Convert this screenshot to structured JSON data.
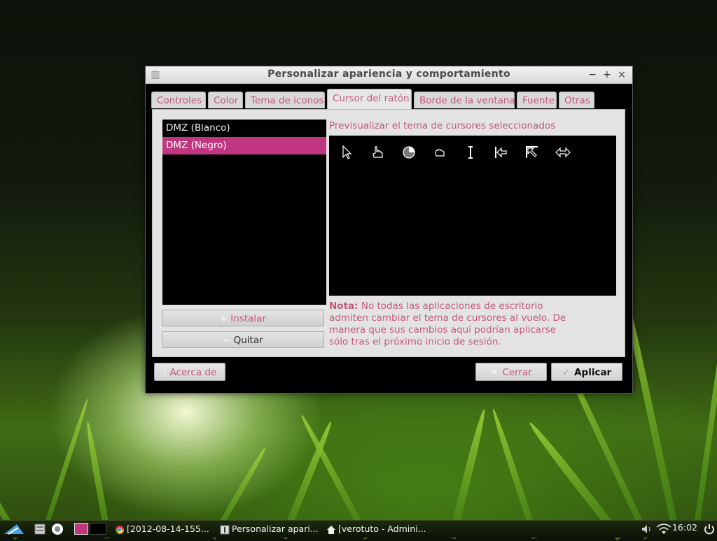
{
  "window": {
    "title": "Personalizar apariencia y comportamiento",
    "controls": {
      "minimize": "−",
      "maximize": "+",
      "close": "×"
    }
  },
  "tabs": [
    {
      "label": "Controles"
    },
    {
      "label": "Color"
    },
    {
      "label": "Tema de iconos"
    },
    {
      "label": "Cursor del ratón"
    },
    {
      "label": "Borde de la ventana"
    },
    {
      "label": "Fuente"
    },
    {
      "label": "Otras"
    }
  ],
  "active_tab": "Cursor del ratón",
  "cursor_themes": [
    {
      "label": "DMZ (Blanco)"
    },
    {
      "label": "DMZ (Negro)",
      "selected": true
    }
  ],
  "buttons": {
    "install": "Instalar",
    "remove": "Quitar",
    "about": "Acerca de",
    "close": "Cerrar",
    "apply": "Aplicar"
  },
  "preview": {
    "label": "Previsualizar el tema de cursores seleccionados",
    "cursors": [
      "arrow-cursor",
      "hand-pointer-cursor",
      "busy-cursor",
      "grab-cursor",
      "text-ibeam-cursor",
      "left-side-resize-cursor",
      "top-left-corner-resize-cursor",
      "horizontal-resize-cursor"
    ]
  },
  "note": {
    "prefix": "Nota:",
    "text": "No todas las aplicaciones de escritorio admiten cambiar el tema de cursores al vuelo. De manera que sus cambios aquí podrían aplicarse sólo tras el próximo inicio de sesión."
  },
  "taskbar": {
    "tasks": [
      {
        "label": "[2012-08-14-155...",
        "icon": "chrome-icon"
      },
      {
        "label": "Personalizar apari...",
        "icon": "settings-icon"
      },
      {
        "label": "[verotuto - Admini...",
        "icon": "home-icon"
      }
    ],
    "clock": "16:02"
  },
  "colors": {
    "accent": "#c0367f",
    "tab_text": "#c25b75"
  }
}
